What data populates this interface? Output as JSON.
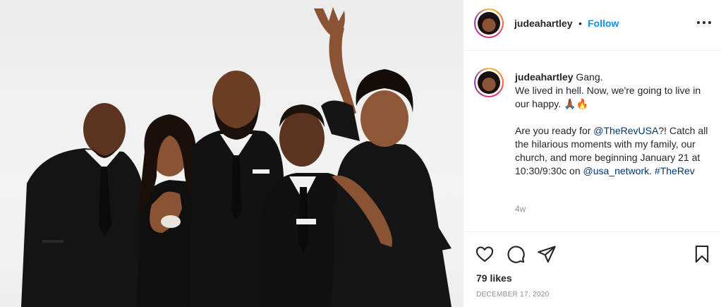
{
  "post": {
    "photo_alt": "Cast photo of five people dressed in black",
    "author": {
      "username": "judeahartley",
      "avatar_icon": "profile-avatar-icon",
      "dot": "•",
      "follow_label": "Follow"
    },
    "menu_icon": "more-options-icon",
    "caption": {
      "username": "judeahartley",
      "line1": "Gang.",
      "line2": "We lived in hell. Now, we're going to live in our happy. 🙏🏾🔥",
      "line3_prefix": "Are you ready for ",
      "mention1": "@TheRevUSA",
      "line3_suffix": "?! Catch all the hilarious moments with my family, our church, and more beginning January 21 at 10:30/9:30c on ",
      "mention2": "@usa_network",
      "line3_sep": ". ",
      "hashtag": "#TheRev"
    },
    "time_ago": "4w",
    "actions": {
      "like_icon": "heart-icon",
      "comment_icon": "comment-icon",
      "share_icon": "share-icon",
      "save_icon": "bookmark-icon"
    },
    "likes": "79 likes",
    "date": "DECEMBER 17, 2020"
  },
  "colors": {
    "accent": "#0095f6",
    "link": "#00376b",
    "muted": "#8e8e8e",
    "text": "#262626"
  }
}
